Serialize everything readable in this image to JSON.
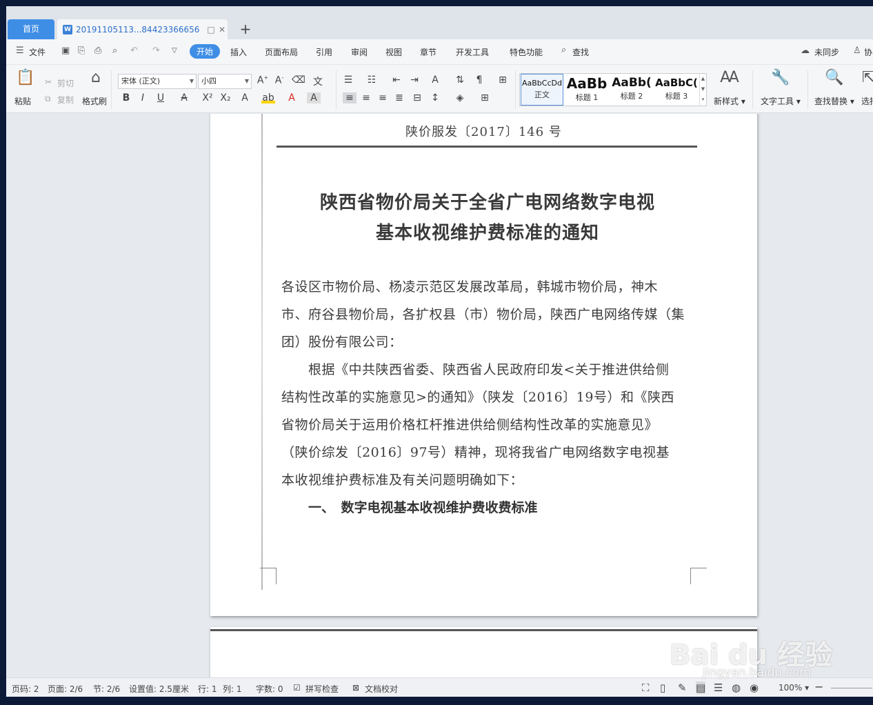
{
  "tabs": {
    "home": "首页",
    "doc_title": "20191105113...84423366656",
    "doc_icon": "W",
    "pin_icon": "□",
    "close_icon": "✕",
    "add_icon": "+"
  },
  "menu": {
    "file": "文件",
    "items": [
      "开始",
      "插入",
      "页面布局",
      "引用",
      "审阅",
      "视图",
      "章节",
      "开发工具",
      "特色功能"
    ],
    "search": "查找",
    "sync": "未同步",
    "collab": "协"
  },
  "ribbon": {
    "paste": "粘贴",
    "cut": "剪切",
    "copy": "复制",
    "format_painter": "格式刷",
    "font_name": "宋体 (正文)",
    "font_size": "小四",
    "styles": [
      {
        "sample": "AaBbCcDd",
        "name": "正文"
      },
      {
        "sample": "AaBb",
        "name": "标题 1"
      },
      {
        "sample": "AaBb(",
        "name": "标题 2"
      },
      {
        "sample": "AaBbC(",
        "name": "标题 3"
      }
    ],
    "new_style": "新样式",
    "text_tools": "文字工具",
    "find_replace": "查找替换",
    "select": "选择"
  },
  "document": {
    "number": "陕价服发〔2017〕146 号",
    "title_line1": "陕西省物价局关于全省广电网络数字电视",
    "title_line2": "基本收视维护费标准的通知",
    "body": [
      "各设区市物价局、杨凌示范区发展改革局，韩城市物价局，神木",
      "市、府谷县物价局，各扩权县（市）物价局，陕西广电网络传媒（集",
      "团）股份有限公司：",
      "　　根据《中共陕西省委、陕西省人民政府印发<关于推进供给侧",
      "结构性改革的实施意见>的通知》（陕发〔2016〕19号）和《陕西",
      "省物价局关于运用价格杠杆推进供给侧结构性改革的实施意见》",
      "（陕价综发〔2016〕97号）精神，现将我省广电网络数字电视基",
      "本收视维护费标准及有关问题明确如下："
    ],
    "section1": "一、　数字电视基本收视维护费收费标准"
  },
  "status": {
    "page_code": "页码: 2",
    "pages": "页面: 2/6",
    "section": "节: 2/6",
    "setting": "设置值: 2.5厘米",
    "row": "行: 1",
    "col": "列: 1",
    "words": "字数: 0",
    "spell": "拼写检查",
    "proof": "文档校对",
    "zoom": "100%"
  },
  "watermark": {
    "main": "Bai du 经验",
    "sub": "jingyan.baidu.com"
  }
}
